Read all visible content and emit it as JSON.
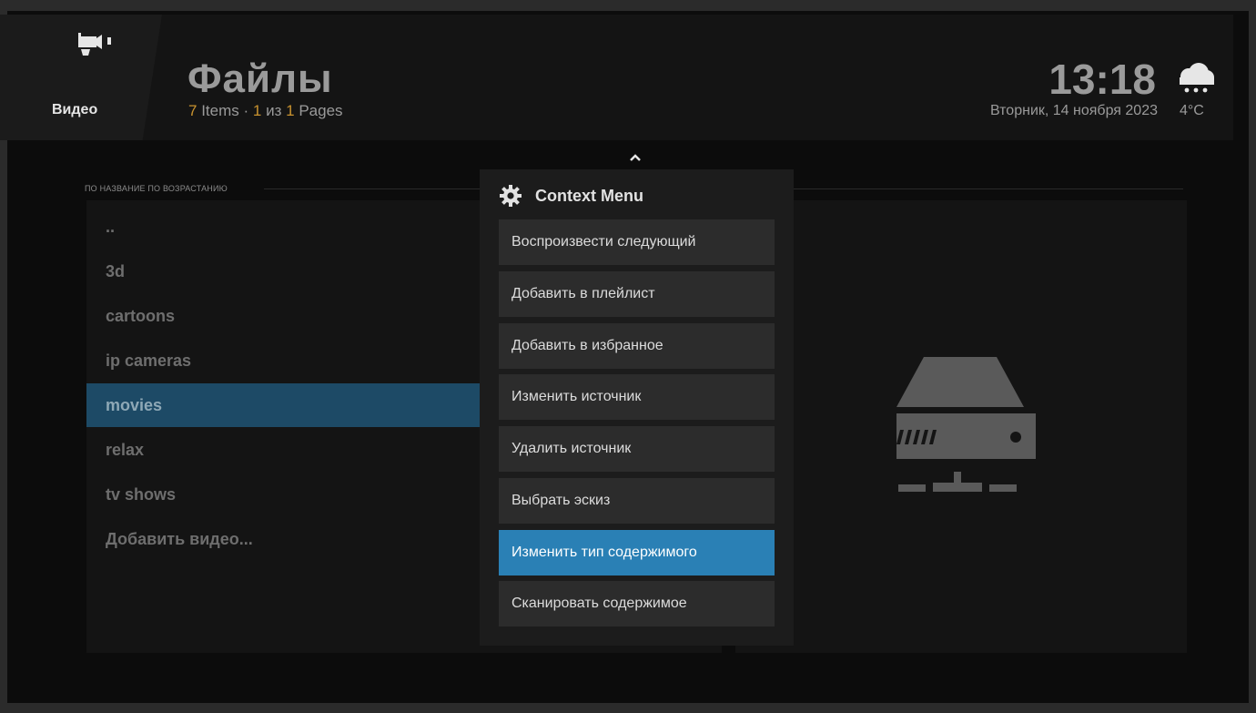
{
  "header": {
    "section_label": "Видео",
    "title": "Файлы",
    "items_count": "7",
    "items_word": "Items",
    "separator": "·",
    "page_current": "1",
    "page_of": "из",
    "page_total": "1",
    "pages_word": "Pages",
    "time": "13:18",
    "date": "Вторник, 14 ноября 2023",
    "temperature": "4°C",
    "weather_icon": "rain-cloud-icon",
    "section_icon": "video-camera-icon"
  },
  "sort_label": "по название по возрастанию",
  "list": {
    "items": [
      {
        "label": ".."
      },
      {
        "label": "3d"
      },
      {
        "label": "cartoons"
      },
      {
        "label": "ip cameras"
      },
      {
        "label": "movies"
      },
      {
        "label": "relax"
      },
      {
        "label": "tv shows"
      },
      {
        "label": "Добавить видео..."
      }
    ],
    "focused_index": 4
  },
  "preview": {
    "icon": "network-drive-icon"
  },
  "context_menu": {
    "title": "Context Menu",
    "icon": "gear-icon",
    "items": [
      {
        "label": "Воспроизвести следующий"
      },
      {
        "label": "Добавить в плейлист"
      },
      {
        "label": "Добавить в избранное"
      },
      {
        "label": "Изменить источник"
      },
      {
        "label": "Удалить источник"
      },
      {
        "label": "Выбрать эскиз"
      },
      {
        "label": "Изменить тип содержимого"
      },
      {
        "label": "Сканировать содержимое"
      }
    ],
    "selected_index": 6
  },
  "colors": {
    "accent_orange": "#c8922f",
    "focus_blue": "#2a80b5",
    "list_focus": "#1d4a66"
  }
}
